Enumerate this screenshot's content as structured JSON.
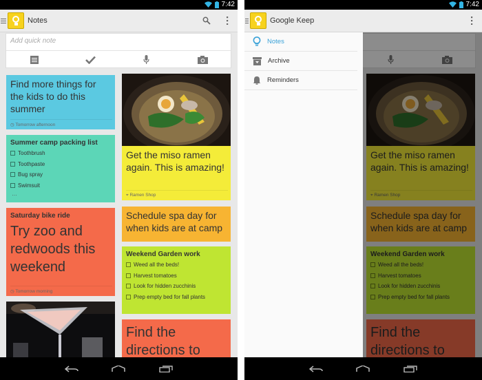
{
  "status": {
    "time": "7:42",
    "wifi_icon": "wifi-icon",
    "battery_icon": "battery-icon"
  },
  "left_screen": {
    "title": "Notes",
    "search_icon": "search-icon",
    "overflow_icon": "overflow-menu-icon",
    "quick_note_placeholder": "Add quick note",
    "quick_actions": [
      "text-note-icon",
      "checklist-icon",
      "microphone-icon",
      "camera-icon"
    ],
    "notes": {
      "kids": {
        "text": "Find more things for the kids to do this summer",
        "reminder": "Tomorrow afternoon",
        "color": "#5bc9e1"
      },
      "summer_camp": {
        "title": "Summer camp packing list",
        "items": [
          "Toothbrush",
          "Toothpaste",
          "Bug spray",
          "Swimsuit"
        ],
        "more": "…",
        "color": "#5cd6b7"
      },
      "bike": {
        "title": "Saturday bike ride",
        "text": "Try zoo and redwoods this weekend",
        "reminder": "Tomorrow morning",
        "color": "#f46a4a"
      },
      "ramen": {
        "text": "Get the miso ramen again. This is amazing!",
        "location": "Ramen Shop",
        "color": "#f4ec39"
      },
      "spa": {
        "text": "Schedule spa day for when kids are at camp",
        "color": "#f7b432"
      },
      "garden": {
        "title": "Weekend Garden work",
        "items": [
          "Weed all the beds!",
          "Harvest tomatoes",
          "Look for hidden zucchinis",
          "Prep empty bed for fall plants"
        ],
        "color": "#bfe532"
      },
      "directions": {
        "text": "Find the directions to",
        "color": "#f46a4a"
      }
    }
  },
  "right_screen": {
    "title": "Google Keep",
    "overflow_icon": "overflow-menu-icon",
    "drawer": [
      {
        "label": "Notes",
        "icon": "lightbulb-icon",
        "active": true
      },
      {
        "label": "Archive",
        "icon": "archive-icon",
        "active": false
      },
      {
        "label": "Reminders",
        "icon": "bell-icon",
        "active": false
      }
    ]
  },
  "nav_buttons": [
    "back-icon",
    "home-icon",
    "recents-icon"
  ]
}
